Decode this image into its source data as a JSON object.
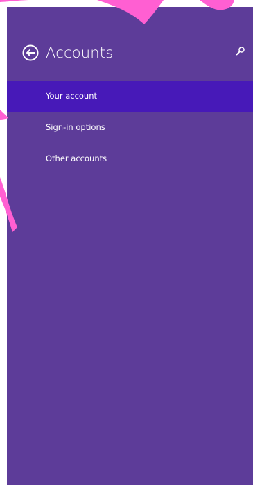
{
  "app": {
    "title": "Accounts"
  },
  "header": {
    "back_icon": "back-arrow-circle-icon",
    "search_icon": "search-icon"
  },
  "nav": {
    "items": [
      {
        "label": "Your account",
        "selected": true
      },
      {
        "label": "Sign-in options",
        "selected": false
      },
      {
        "label": "Other accounts",
        "selected": false
      }
    ]
  },
  "colors": {
    "pane_bg": "#5d3c99",
    "selected_bg": "#4719b8",
    "annotation_pink": "#ff5fd2",
    "text": "#ffffff"
  }
}
